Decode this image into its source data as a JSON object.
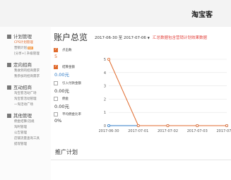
{
  "header": {
    "brand": "淘宝客"
  },
  "sidebar": {
    "sections": [
      {
        "label": "计划管理",
        "items": [
          "CPS计划管理",
          "营销计划",
          "[分享+] 升级管理"
        ],
        "badge": "hot"
      },
      {
        "label": "定向招商",
        "items": [
          "我收到的招商需求",
          "我参加的招商需求"
        ]
      },
      {
        "label": "互动招商",
        "items": [
          "淘宝客活动广场",
          "淘宝客活动管理",
          "一淘活动广场"
        ]
      },
      {
        "label": "其他管理",
        "items": [
          "佣金结算/违规",
          "淘利管理",
          "公告管理",
          "店铺流量查询工具",
          "提现管理"
        ]
      }
    ]
  },
  "main": {
    "title": "账户总览",
    "date_range": "2017-06-30 至 2017-07-06",
    "hint": "汇总数据包含营销计划效果数据",
    "metrics": [
      {
        "label": "点击数",
        "value": "5",
        "checked": true,
        "value_color": "#e06a2c"
      },
      {
        "label": "结算金额",
        "value": "0.00元",
        "checked": true,
        "value_color": "#2b78c5"
      },
      {
        "label": "引入付款金额",
        "value": "0.00元",
        "checked": false,
        "value_color": "#333333"
      },
      {
        "label": "佣金",
        "value": "0.00元",
        "checked": false,
        "value_color": "#333333"
      },
      {
        "label": "平均佣金比率",
        "value": "0%",
        "checked": false,
        "value_color": "#333333"
      }
    ],
    "section_title": "推广计划"
  },
  "chart_data": {
    "type": "line",
    "categories": [
      "2017-06-30",
      "2017-07-01",
      "2017-07-02",
      "2017-07-03",
      "2017-07-04"
    ],
    "series": [
      {
        "name": "点击数",
        "color": "#e06a2c",
        "values": [
          5,
          0,
          0,
          0,
          0
        ]
      },
      {
        "name": "结算金额",
        "color": "#2b78c5",
        "values": [
          0,
          0,
          0,
          0,
          0
        ]
      }
    ],
    "yticks": [
      0,
      1,
      2,
      3,
      4,
      5
    ],
    "ylim": [
      0,
      5
    ],
    "grid": true
  }
}
